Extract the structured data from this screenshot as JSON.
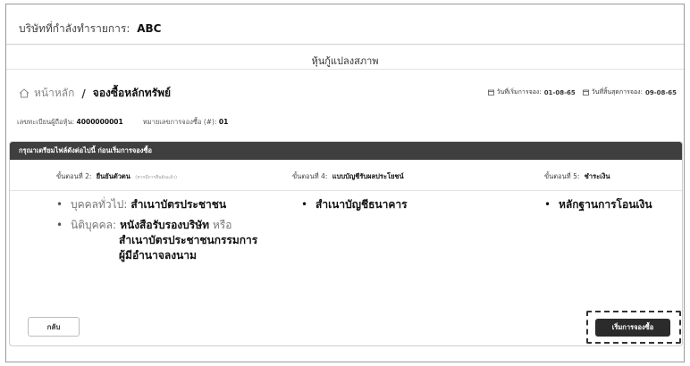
{
  "company": {
    "label": "บริษัทที่กำลังทำรายการ:",
    "value": "ABC"
  },
  "page_title": "หุ้นกู้แปลงสภาพ",
  "breadcrumb": {
    "home": "หน้าหลัก",
    "separator": "/",
    "current": "จองซื้อหลักทรัพย์"
  },
  "dates": {
    "start_label": "วันที่เริ่มการจอง:",
    "start_value": "01-08-65",
    "end_label": "วันที่สิ้นสุดการจอง:",
    "end_value": "09-08-65"
  },
  "info": {
    "holder_label": "เลขทะเบียนผู้ถือหุ้น:",
    "holder_value": "4000000001",
    "sub_no_label": "หมายเลขการจองซื้อ (#):",
    "sub_no_value": "01"
  },
  "panel": {
    "header": "กรุณาเตรียมไฟล์ดังต่อไปนี้ ก่อนเริ่มการจองซื้อ",
    "steps": [
      {
        "prefix": "ขั้นตอนที่ 2:",
        "title": "ยืนยันตัวตน",
        "note": "(หากมีการยืนยันแล้ว)"
      },
      {
        "prefix": "ขั้นตอนที่ 4:",
        "title": "แบบบัญชีรับผลประโยชน์",
        "note": ""
      },
      {
        "prefix": "ขั้นตอนที่ 5:",
        "title": "ชำระเงิน",
        "note": ""
      }
    ],
    "col1": {
      "item1_label": "บุคคลทั่วไป:",
      "item1_value": "สำเนาบัตรประชาชน",
      "item2_label": "นิติบุคคล:",
      "item2_value": "หนังสือรับรองบริษัท",
      "item2_suffix": "หรือ",
      "item2_line2": "สำเนาบัตรประชาชนกรรมการ",
      "item2_line3": "ผู้มีอำนาจลงนาม"
    },
    "col2": {
      "item1": "สำเนาบัญชีธนาคาร"
    },
    "col3": {
      "item1": "หลักฐานการโอนเงิน"
    },
    "back_button": "กลับ",
    "start_button": "เริ่มการจองซื้อ"
  }
}
